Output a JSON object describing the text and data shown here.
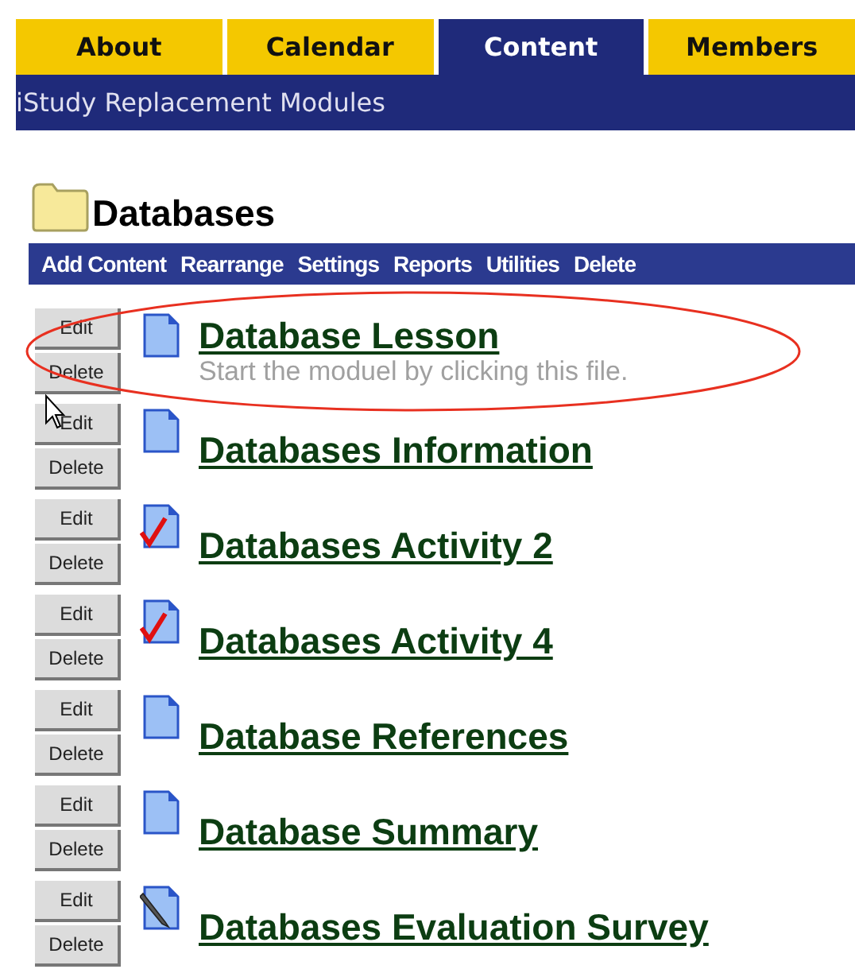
{
  "tabs": [
    {
      "label": "About",
      "selected": false
    },
    {
      "label": "Calendar",
      "selected": false
    },
    {
      "label": "Content",
      "selected": true
    },
    {
      "label": "Members",
      "selected": false
    }
  ],
  "breadcrumb": "iStudy Replacement Modules",
  "folder": {
    "title": "Databases"
  },
  "toolbar": [
    "Add Content",
    "Rearrange",
    "Settings",
    "Reports",
    "Utilities",
    "Delete"
  ],
  "items": [
    {
      "kind": "document",
      "title": "Database Lesson",
      "description": "Start the moduel by clicking this file.",
      "highlighted": true,
      "edit": "Edit",
      "delete": "Delete"
    },
    {
      "kind": "document",
      "title": "Databases Information",
      "highlighted": false,
      "edit": "Edit",
      "delete": "Delete"
    },
    {
      "kind": "activity",
      "title": "Databases Activity 2",
      "highlighted": false,
      "edit": "Edit",
      "delete": "Delete"
    },
    {
      "kind": "activity",
      "title": "Databases Activity 4",
      "highlighted": false,
      "edit": "Edit",
      "delete": "Delete"
    },
    {
      "kind": "document",
      "title": "Database References",
      "highlighted": false,
      "edit": "Edit",
      "delete": "Delete"
    },
    {
      "kind": "document",
      "title": "Database Summary",
      "highlighted": false,
      "edit": "Edit",
      "delete": "Delete"
    },
    {
      "kind": "survey",
      "title": "Databases Evaluation Survey",
      "highlighted": false,
      "edit": "Edit",
      "delete": "Delete"
    }
  ]
}
